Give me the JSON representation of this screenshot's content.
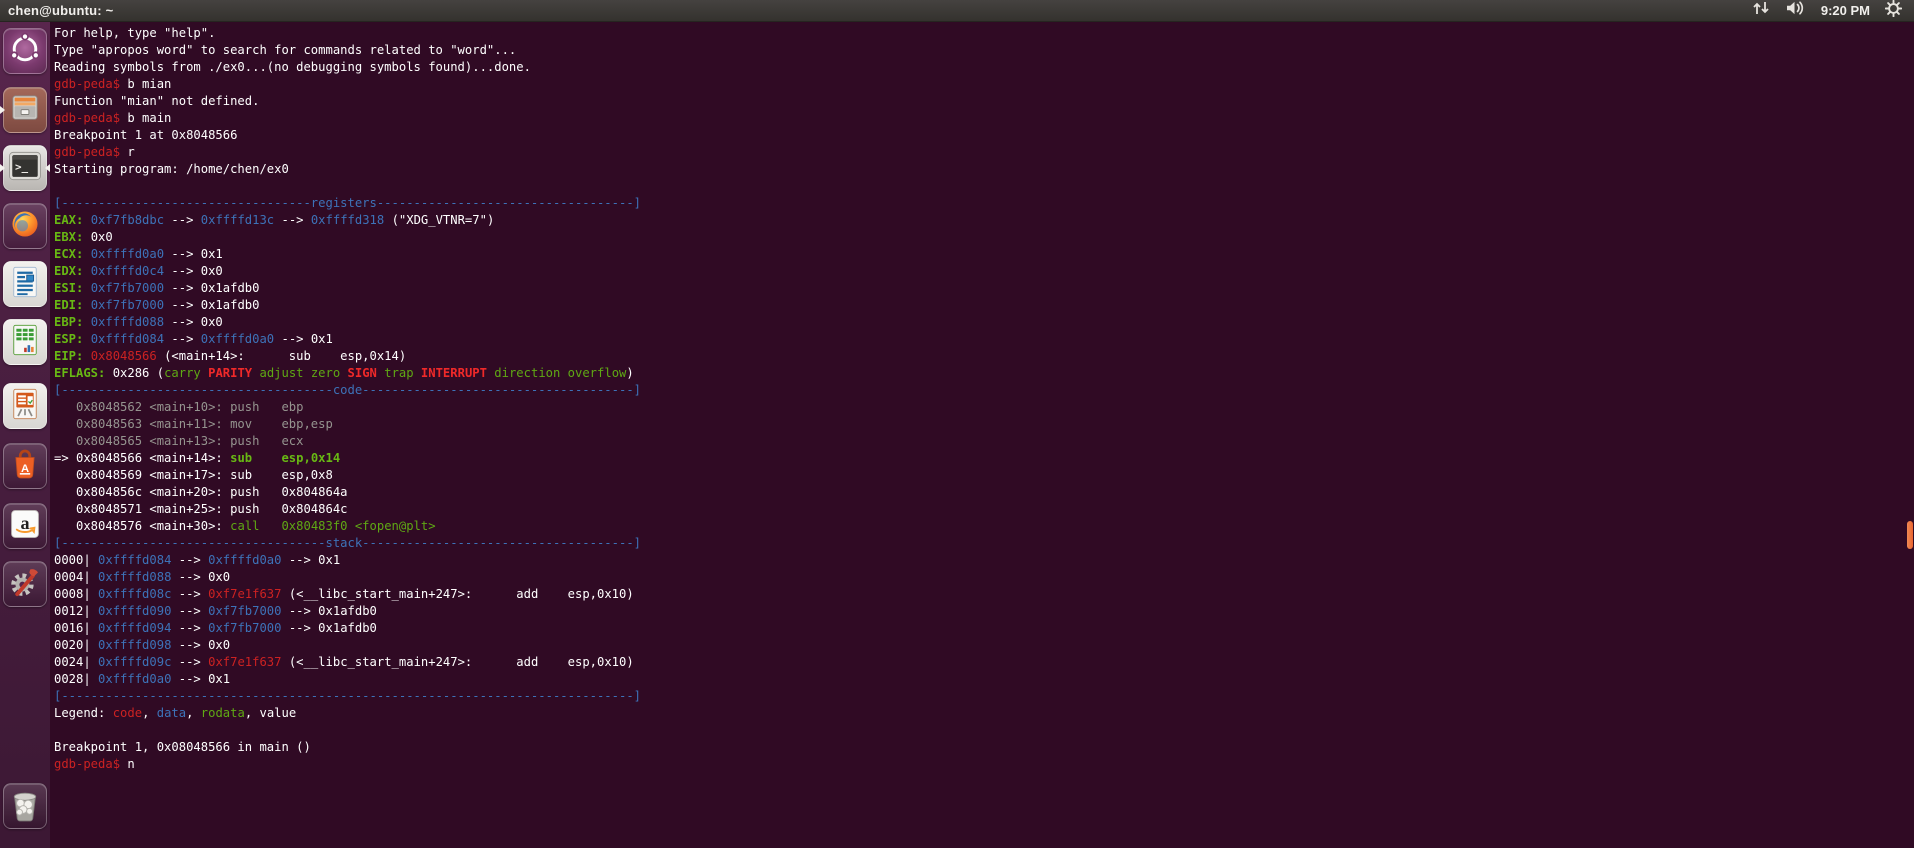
{
  "panel": {
    "title": "chen@ubuntu: ~",
    "clock": "9:20 PM",
    "icons": [
      "network-updown-icon",
      "volume-icon",
      "session-gear-icon"
    ]
  },
  "launcher": {
    "items": [
      {
        "name": "dash-home",
        "icon": "ubuntu-logo-icon",
        "running": false
      },
      {
        "name": "files",
        "icon": "file-cabinet-icon",
        "running": true
      },
      {
        "name": "terminal",
        "icon": "terminal-icon",
        "running": true,
        "focused": true
      },
      {
        "name": "firefox",
        "icon": "firefox-icon",
        "running": false
      },
      {
        "name": "libreoffice-writer",
        "icon": "writer-icon",
        "running": false
      },
      {
        "name": "libreoffice-calc",
        "icon": "calc-icon",
        "running": false
      },
      {
        "name": "libreoffice-impress",
        "icon": "impress-icon",
        "running": false
      },
      {
        "name": "ubuntu-software",
        "icon": "software-center-icon",
        "running": false
      },
      {
        "name": "amazon",
        "icon": "amazon-icon",
        "running": false
      },
      {
        "name": "system-settings",
        "icon": "settings-icon",
        "running": false
      },
      {
        "name": "trash",
        "icon": "trash-icon",
        "running": false
      }
    ]
  },
  "colors": {
    "terminal_bg": "#300a24",
    "panel_bg": "#3c3a36",
    "launcher_bg": "#4a1f41",
    "scrollbar_orange": "#e9632f",
    "ansi_red": "#cc2222",
    "ansi_bright_red": "#ef2929",
    "ansi_green": "#5fa814",
    "ansi_blue": "#3d72b8",
    "ansi_gray": "#95948f",
    "ansi_white": "#ffffff"
  },
  "terminal": {
    "lines": [
      [
        [
          "w",
          "For help, type \"help\"."
        ]
      ],
      [
        [
          "w",
          "Type \"apropos word\" to search for commands related to \"word\"..."
        ]
      ],
      [
        [
          "w",
          "Reading symbols from ./ex0...(no debugging symbols found)...done."
        ]
      ],
      [
        [
          "r",
          "gdb-peda$ "
        ],
        [
          "w",
          "b mian"
        ]
      ],
      [
        [
          "w",
          "Function \"mian\" not defined."
        ]
      ],
      [
        [
          "r",
          "gdb-peda$ "
        ],
        [
          "w",
          "b main"
        ]
      ],
      [
        [
          "w",
          "Breakpoint 1 at 0x8048566"
        ]
      ],
      [
        [
          "r",
          "gdb-peda$ "
        ],
        [
          "w",
          "r"
        ]
      ],
      [
        [
          "w",
          "Starting program: /home/chen/ex0 "
        ]
      ],
      [],
      [
        [
          "b",
          "[----------------------------------registers-----------------------------------]"
        ]
      ],
      [
        [
          "G",
          "EAX: "
        ],
        [
          "b",
          "0xf7fb8dbc "
        ],
        [
          "w",
          "--> "
        ],
        [
          "b",
          "0xffffd13c "
        ],
        [
          "w",
          "--> "
        ],
        [
          "b",
          "0xffffd318 "
        ],
        [
          "w",
          "(\"XDG_VTNR=7\")"
        ]
      ],
      [
        [
          "G",
          "EBX: "
        ],
        [
          "w",
          "0x0"
        ]
      ],
      [
        [
          "G",
          "ECX: "
        ],
        [
          "b",
          "0xffffd0a0 "
        ],
        [
          "w",
          "--> 0x1"
        ]
      ],
      [
        [
          "G",
          "EDX: "
        ],
        [
          "b",
          "0xffffd0c4 "
        ],
        [
          "w",
          "--> 0x0"
        ]
      ],
      [
        [
          "G",
          "ESI: "
        ],
        [
          "b",
          "0xf7fb7000 "
        ],
        [
          "w",
          "--> 0x1afdb0"
        ]
      ],
      [
        [
          "G",
          "EDI: "
        ],
        [
          "b",
          "0xf7fb7000 "
        ],
        [
          "w",
          "--> 0x1afdb0"
        ]
      ],
      [
        [
          "G",
          "EBP: "
        ],
        [
          "b",
          "0xffffd088 "
        ],
        [
          "w",
          "--> 0x0"
        ]
      ],
      [
        [
          "G",
          "ESP: "
        ],
        [
          "b",
          "0xffffd084 "
        ],
        [
          "w",
          "--> "
        ],
        [
          "b",
          "0xffffd0a0 "
        ],
        [
          "w",
          "--> 0x1"
        ]
      ],
      [
        [
          "G",
          "EIP: "
        ],
        [
          "r",
          "0x8048566 "
        ],
        [
          "w",
          "(<main+14>:      sub    esp,0x14)"
        ]
      ],
      [
        [
          "G",
          "EFLAGS: "
        ],
        [
          "w",
          "0x286 ("
        ],
        [
          "g",
          "carry "
        ],
        [
          "R",
          "PARITY "
        ],
        [
          "g",
          "adjust zero "
        ],
        [
          "R",
          "SIGN "
        ],
        [
          "g",
          "trap "
        ],
        [
          "R",
          "INTERRUPT "
        ],
        [
          "g",
          "direction overflow"
        ],
        [
          "w",
          ")"
        ]
      ],
      [
        [
          "b",
          "[-------------------------------------code-------------------------------------]"
        ]
      ],
      [
        [
          "d",
          "   0x8048562 <main+10>: push   ebp"
        ]
      ],
      [
        [
          "d",
          "   0x8048563 <main+11>: mov    ebp,esp"
        ]
      ],
      [
        [
          "d",
          "   0x8048565 <main+13>: push   ecx"
        ]
      ],
      [
        [
          "w",
          "=> 0x8048566 <main+14>: "
        ],
        [
          "G",
          "sub    esp,0x14"
        ]
      ],
      [
        [
          "w",
          "   0x8048569 <main+17>: sub    esp,0x8"
        ]
      ],
      [
        [
          "w",
          "   0x804856c <main+20>: push   0x804864a"
        ]
      ],
      [
        [
          "w",
          "   0x8048571 <main+25>: push   0x804864c"
        ]
      ],
      [
        [
          "w",
          "   0x8048576 <main+30>: "
        ],
        [
          "g",
          "call   0x80483f0 <fopen@plt>"
        ]
      ],
      [
        [
          "b",
          "[------------------------------------stack-------------------------------------]"
        ]
      ],
      [
        [
          "w",
          "0000| "
        ],
        [
          "b",
          "0xffffd084 "
        ],
        [
          "w",
          "--> "
        ],
        [
          "b",
          "0xffffd0a0 "
        ],
        [
          "w",
          "--> 0x1"
        ]
      ],
      [
        [
          "w",
          "0004| "
        ],
        [
          "b",
          "0xffffd088 "
        ],
        [
          "w",
          "--> 0x0"
        ]
      ],
      [
        [
          "w",
          "0008| "
        ],
        [
          "b",
          "0xffffd08c "
        ],
        [
          "w",
          "--> "
        ],
        [
          "r",
          "0xf7e1f637 "
        ],
        [
          "w",
          "(<__libc_start_main+247>:      add    esp,0x10)"
        ]
      ],
      [
        [
          "w",
          "0012| "
        ],
        [
          "b",
          "0xffffd090 "
        ],
        [
          "w",
          "--> "
        ],
        [
          "b",
          "0xf7fb7000 "
        ],
        [
          "w",
          "--> 0x1afdb0"
        ]
      ],
      [
        [
          "w",
          "0016| "
        ],
        [
          "b",
          "0xffffd094 "
        ],
        [
          "w",
          "--> "
        ],
        [
          "b",
          "0xf7fb7000 "
        ],
        [
          "w",
          "--> 0x1afdb0"
        ]
      ],
      [
        [
          "w",
          "0020| "
        ],
        [
          "b",
          "0xffffd098 "
        ],
        [
          "w",
          "--> 0x0"
        ]
      ],
      [
        [
          "w",
          "0024| "
        ],
        [
          "b",
          "0xffffd09c "
        ],
        [
          "w",
          "--> "
        ],
        [
          "r",
          "0xf7e1f637 "
        ],
        [
          "w",
          "(<__libc_start_main+247>:      add    esp,0x10)"
        ]
      ],
      [
        [
          "w",
          "0028| "
        ],
        [
          "b",
          "0xffffd0a0 "
        ],
        [
          "w",
          "--> 0x1"
        ]
      ],
      [
        [
          "b",
          "[------------------------------------------------------------------------------]"
        ]
      ],
      [
        [
          "w",
          "Legend: "
        ],
        [
          "r",
          "code"
        ],
        [
          "w",
          ", "
        ],
        [
          "b",
          "data"
        ],
        [
          "w",
          ", "
        ],
        [
          "g",
          "rodata"
        ],
        [
          "w",
          ", value"
        ]
      ],
      [],
      [
        [
          "w",
          "Breakpoint 1, 0x08048566 in main ()"
        ]
      ],
      [
        [
          "r",
          "gdb-peda$ "
        ],
        [
          "w",
          "n"
        ]
      ]
    ]
  }
}
